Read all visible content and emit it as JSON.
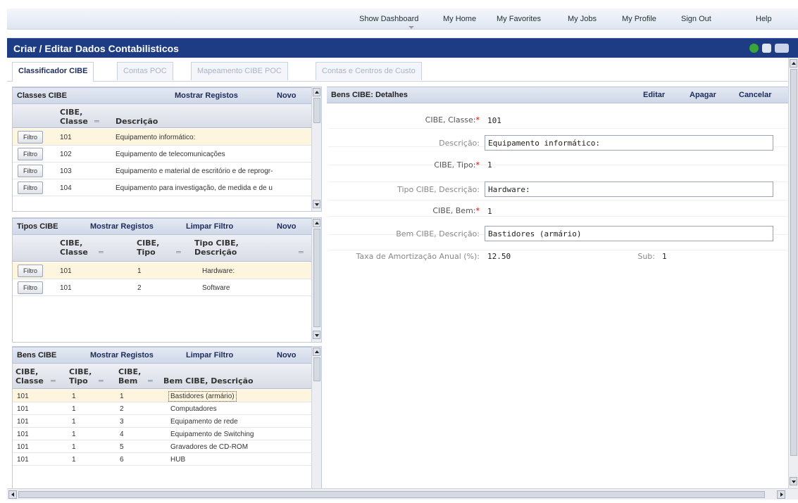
{
  "topnav": {
    "links": [
      "Show Dashboard",
      "My Home",
      "My Favorites",
      "My Jobs",
      "My Profile",
      "Sign Out",
      "Help"
    ]
  },
  "title": "Criar / Editar Dados Contabilisticos",
  "tabs": [
    "Classificador CIBE",
    "Contas POC",
    "Mapeamento CIBE POC",
    "Contas e Centros de Custo"
  ],
  "classes_panel": {
    "title": "Classes CIBE",
    "show_records": "Mostrar Registos",
    "new": "Novo",
    "col_classe": [
      "CIBE,",
      "Classe"
    ],
    "col_desc": "Descrição",
    "sort_glyph": "═",
    "filter_label": "Filtro",
    "rows": [
      {
        "classe": "101",
        "descricao": "Equipamento informático:"
      },
      {
        "classe": "102",
        "descricao": "Equipamento de telecomunicações"
      },
      {
        "classe": "103",
        "descricao": "Equipamento e material de escritório e de reprogr-"
      },
      {
        "classe": "104",
        "descricao": "Equipamento para investigação, de medida e de u"
      }
    ]
  },
  "tipos_panel": {
    "title": "Tipos CIBE",
    "show_records": "Mostrar Registos",
    "clear_filter": "Limpar Filtro",
    "new": "Novo",
    "col_classe": [
      "CIBE,",
      "Classe"
    ],
    "col_tipo": [
      "CIBE,",
      "Tipo"
    ],
    "col_desc": [
      "Tipo CIBE,",
      "Descrição"
    ],
    "filter_label": "Filtro",
    "rows": [
      {
        "classe": "101",
        "tipo": "1",
        "descricao": "Hardware:"
      },
      {
        "classe": "101",
        "tipo": "2",
        "descricao": "Software"
      }
    ]
  },
  "bens_panel": {
    "title": "Bens CIBE",
    "show_records": "Mostrar Registos",
    "clear_filter": "Limpar Filtro",
    "new": "Novo",
    "col_classe": [
      "CIBE,",
      "Classe"
    ],
    "col_tipo": [
      "CIBE,",
      "Tipo"
    ],
    "col_bem": [
      "CIBE,",
      "Bem"
    ],
    "col_desc": "Bem CIBE, Descrição",
    "rows": [
      {
        "classe": "101",
        "tipo": "1",
        "bem": "1",
        "descricao": "Bastidores (armário)"
      },
      {
        "classe": "101",
        "tipo": "1",
        "bem": "2",
        "descricao": "Computadores"
      },
      {
        "classe": "101",
        "tipo": "1",
        "bem": "3",
        "descricao": "Equipamento de rede"
      },
      {
        "classe": "101",
        "tipo": "1",
        "bem": "4",
        "descricao": "Equipamento de Switching"
      },
      {
        "classe": "101",
        "tipo": "1",
        "bem": "5",
        "descricao": "Gravadores de CD-ROM"
      },
      {
        "classe": "101",
        "tipo": "1",
        "bem": "6",
        "descricao": "HUB"
      }
    ]
  },
  "details": {
    "title": "Bens CIBE: Detalhes",
    "edit": "Editar",
    "delete": "Apagar",
    "cancel": "Cancelar",
    "required_mark": "*",
    "fields": {
      "classe_label": "CIBE, Classe:",
      "classe_value": "101",
      "descricao_label": "Descrição:",
      "descricao_value": "Equipamento informático:",
      "tipo_label": "CIBE, Tipo:",
      "tipo_value": "1",
      "tipo_desc_label": "Tipo CIBE, Descrição:",
      "tipo_desc_value": "Hardware:",
      "bem_label": "CIBE, Bem:",
      "bem_value": "1",
      "bem_desc_label": "Bem CIBE, Descrição:",
      "bem_desc_value": "Bastidores (armário)",
      "taxa_label": "Taxa de Amortização Anual (%):",
      "taxa_value": "12.50",
      "sub_label": "Sub:",
      "sub_value": "1"
    }
  },
  "colors": {
    "title_bar": "#1e3c83",
    "selected_row": "#fdf5dd",
    "required": "#d00000"
  }
}
